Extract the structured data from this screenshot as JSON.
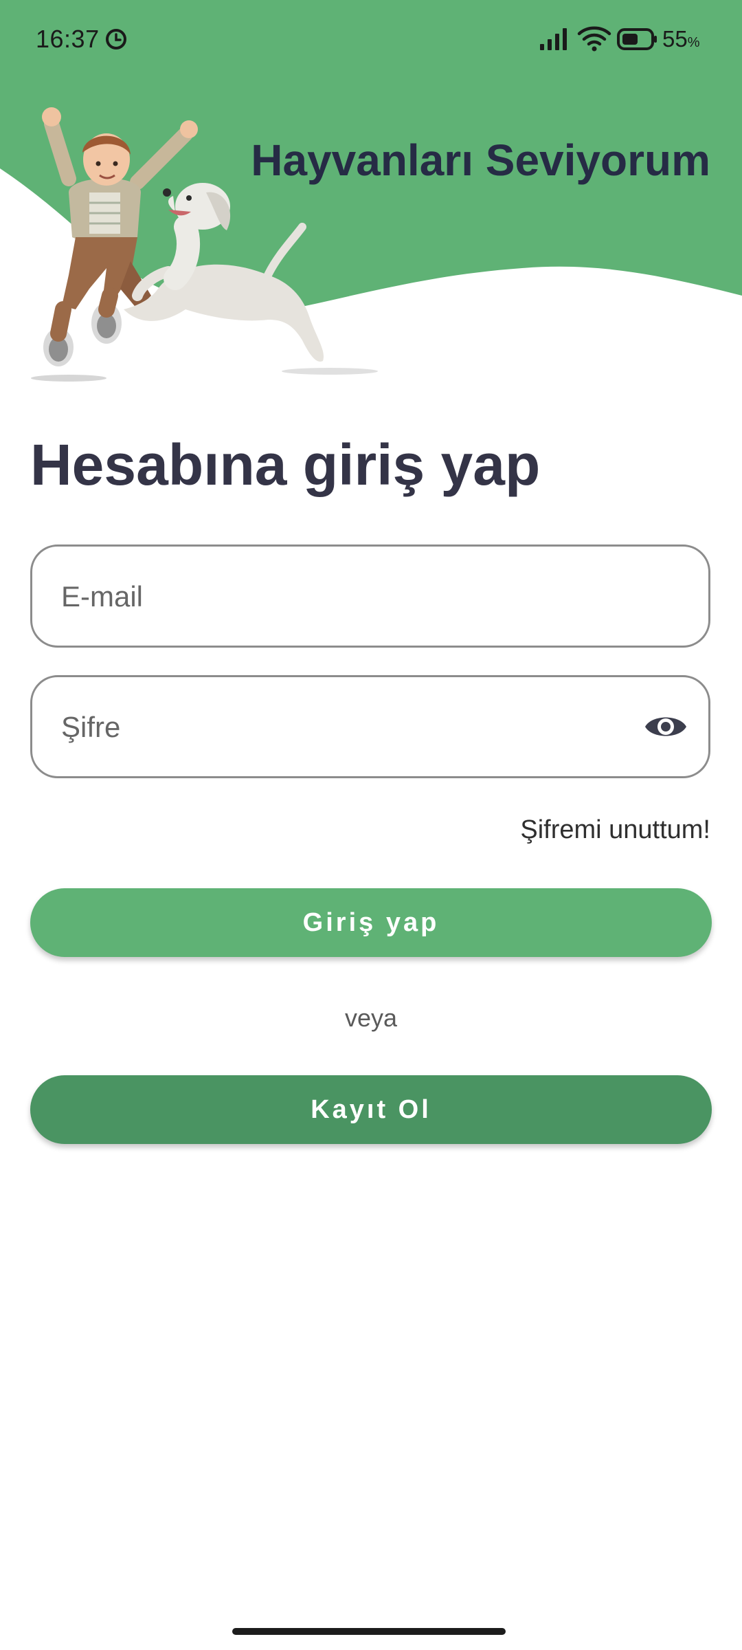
{
  "status_bar": {
    "time": "16:37",
    "battery_level": "55",
    "battery_unit": "%",
    "icons": [
      "alarm-icon",
      "signal-icon",
      "wifi-icon",
      "battery-icon"
    ]
  },
  "header": {
    "app_title": "Hayvanları Seviyorum",
    "background_color": "#5fb275",
    "illustration": "boy-and-dog-jumping"
  },
  "login": {
    "heading": "Hesabına giriş yap",
    "email_placeholder": "E-mail",
    "email_value": "",
    "password_placeholder": "Şifre",
    "password_value": "",
    "password_toggle_icon": "eye-icon",
    "forgot_password": "Şifremi unuttum!",
    "login_button": "Giriş yap",
    "or_text": "veya",
    "signup_button": "Kayıt Ol"
  },
  "colors": {
    "primary_green": "#5fb275",
    "dark_green": "#4a9462",
    "title_text": "#262b45",
    "heading_text": "#343447"
  }
}
